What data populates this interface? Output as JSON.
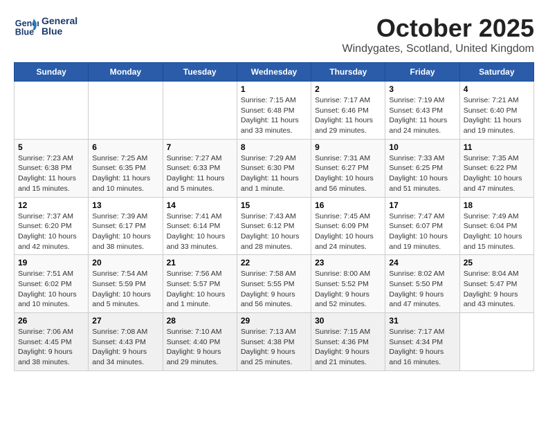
{
  "header": {
    "logo_line1": "General",
    "logo_line2": "Blue",
    "month": "October 2025",
    "location": "Windygates, Scotland, United Kingdom"
  },
  "days_of_week": [
    "Sunday",
    "Monday",
    "Tuesday",
    "Wednesday",
    "Thursday",
    "Friday",
    "Saturday"
  ],
  "weeks": [
    [
      {
        "day": "",
        "info": ""
      },
      {
        "day": "",
        "info": ""
      },
      {
        "day": "",
        "info": ""
      },
      {
        "day": "1",
        "info": "Sunrise: 7:15 AM\nSunset: 6:48 PM\nDaylight: 11 hours and 33 minutes."
      },
      {
        "day": "2",
        "info": "Sunrise: 7:17 AM\nSunset: 6:46 PM\nDaylight: 11 hours and 29 minutes."
      },
      {
        "day": "3",
        "info": "Sunrise: 7:19 AM\nSunset: 6:43 PM\nDaylight: 11 hours and 24 minutes."
      },
      {
        "day": "4",
        "info": "Sunrise: 7:21 AM\nSunset: 6:40 PM\nDaylight: 11 hours and 19 minutes."
      }
    ],
    [
      {
        "day": "5",
        "info": "Sunrise: 7:23 AM\nSunset: 6:38 PM\nDaylight: 11 hours and 15 minutes."
      },
      {
        "day": "6",
        "info": "Sunrise: 7:25 AM\nSunset: 6:35 PM\nDaylight: 11 hours and 10 minutes."
      },
      {
        "day": "7",
        "info": "Sunrise: 7:27 AM\nSunset: 6:33 PM\nDaylight: 11 hours and 5 minutes."
      },
      {
        "day": "8",
        "info": "Sunrise: 7:29 AM\nSunset: 6:30 PM\nDaylight: 11 hours and 1 minute."
      },
      {
        "day": "9",
        "info": "Sunrise: 7:31 AM\nSunset: 6:27 PM\nDaylight: 10 hours and 56 minutes."
      },
      {
        "day": "10",
        "info": "Sunrise: 7:33 AM\nSunset: 6:25 PM\nDaylight: 10 hours and 51 minutes."
      },
      {
        "day": "11",
        "info": "Sunrise: 7:35 AM\nSunset: 6:22 PM\nDaylight: 10 hours and 47 minutes."
      }
    ],
    [
      {
        "day": "12",
        "info": "Sunrise: 7:37 AM\nSunset: 6:20 PM\nDaylight: 10 hours and 42 minutes."
      },
      {
        "day": "13",
        "info": "Sunrise: 7:39 AM\nSunset: 6:17 PM\nDaylight: 10 hours and 38 minutes."
      },
      {
        "day": "14",
        "info": "Sunrise: 7:41 AM\nSunset: 6:14 PM\nDaylight: 10 hours and 33 minutes."
      },
      {
        "day": "15",
        "info": "Sunrise: 7:43 AM\nSunset: 6:12 PM\nDaylight: 10 hours and 28 minutes."
      },
      {
        "day": "16",
        "info": "Sunrise: 7:45 AM\nSunset: 6:09 PM\nDaylight: 10 hours and 24 minutes."
      },
      {
        "day": "17",
        "info": "Sunrise: 7:47 AM\nSunset: 6:07 PM\nDaylight: 10 hours and 19 minutes."
      },
      {
        "day": "18",
        "info": "Sunrise: 7:49 AM\nSunset: 6:04 PM\nDaylight: 10 hours and 15 minutes."
      }
    ],
    [
      {
        "day": "19",
        "info": "Sunrise: 7:51 AM\nSunset: 6:02 PM\nDaylight: 10 hours and 10 minutes."
      },
      {
        "day": "20",
        "info": "Sunrise: 7:54 AM\nSunset: 5:59 PM\nDaylight: 10 hours and 5 minutes."
      },
      {
        "day": "21",
        "info": "Sunrise: 7:56 AM\nSunset: 5:57 PM\nDaylight: 10 hours and 1 minute."
      },
      {
        "day": "22",
        "info": "Sunrise: 7:58 AM\nSunset: 5:55 PM\nDaylight: 9 hours and 56 minutes."
      },
      {
        "day": "23",
        "info": "Sunrise: 8:00 AM\nSunset: 5:52 PM\nDaylight: 9 hours and 52 minutes."
      },
      {
        "day": "24",
        "info": "Sunrise: 8:02 AM\nSunset: 5:50 PM\nDaylight: 9 hours and 47 minutes."
      },
      {
        "day": "25",
        "info": "Sunrise: 8:04 AM\nSunset: 5:47 PM\nDaylight: 9 hours and 43 minutes."
      }
    ],
    [
      {
        "day": "26",
        "info": "Sunrise: 7:06 AM\nSunset: 4:45 PM\nDaylight: 9 hours and 38 minutes."
      },
      {
        "day": "27",
        "info": "Sunrise: 7:08 AM\nSunset: 4:43 PM\nDaylight: 9 hours and 34 minutes."
      },
      {
        "day": "28",
        "info": "Sunrise: 7:10 AM\nSunset: 4:40 PM\nDaylight: 9 hours and 29 minutes."
      },
      {
        "day": "29",
        "info": "Sunrise: 7:13 AM\nSunset: 4:38 PM\nDaylight: 9 hours and 25 minutes."
      },
      {
        "day": "30",
        "info": "Sunrise: 7:15 AM\nSunset: 4:36 PM\nDaylight: 9 hours and 21 minutes."
      },
      {
        "day": "31",
        "info": "Sunrise: 7:17 AM\nSunset: 4:34 PM\nDaylight: 9 hours and 16 minutes."
      },
      {
        "day": "",
        "info": ""
      }
    ]
  ]
}
